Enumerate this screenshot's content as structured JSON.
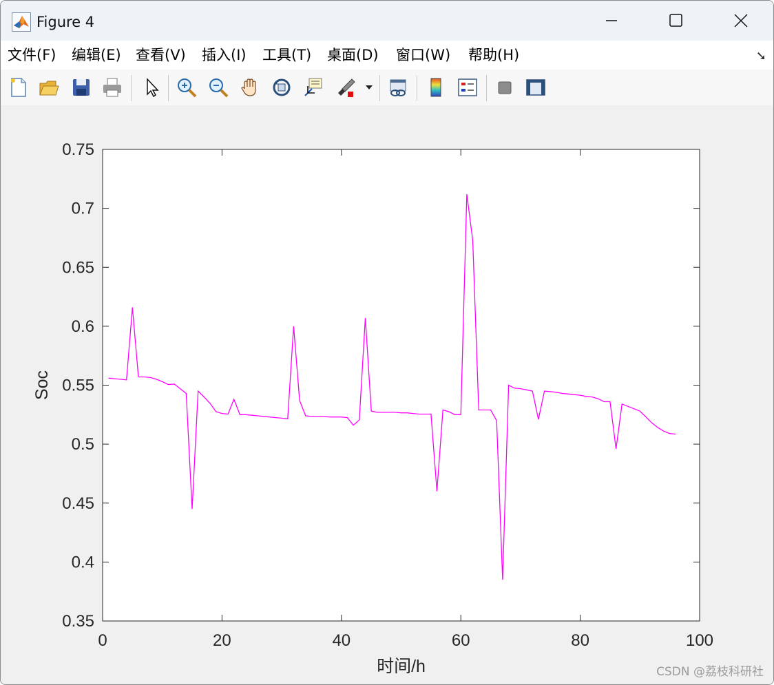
{
  "window": {
    "title": "Figure 4"
  },
  "menu": {
    "items": [
      {
        "label": "文件(F)"
      },
      {
        "label": "编辑(E)"
      },
      {
        "label": "查看(V)"
      },
      {
        "label": "插入(I)"
      },
      {
        "label": "工具(T)"
      },
      {
        "label": "桌面(D)"
      },
      {
        "label": "窗口(W)"
      },
      {
        "label": "帮助(H)"
      }
    ]
  },
  "toolbar": {
    "icons": [
      "new-figure-icon",
      "open-file-icon",
      "save-icon",
      "print-icon",
      "select-arrow-icon",
      "zoom-in-icon",
      "zoom-out-icon",
      "pan-hand-icon",
      "rotate-3d-icon",
      "data-cursor-icon",
      "brush-icon",
      "link-plot-icon",
      "colorbar-icon",
      "legend-icon",
      "hide-plot-tools-icon",
      "show-plot-tools-icon"
    ]
  },
  "colors": {
    "line": "#ff00ff",
    "axes_bg": "#ffffff",
    "figure_bg": "#f0f0f0"
  },
  "watermark": "CSDN @荔枝科研社",
  "chart_data": {
    "type": "line",
    "title": "",
    "xlabel": "时间/h",
    "ylabel": "Soc",
    "xlim": [
      0,
      100
    ],
    "ylim": [
      0.35,
      0.75
    ],
    "xticks": [
      0,
      20,
      40,
      60,
      80,
      100
    ],
    "yticks": [
      0.35,
      0.4,
      0.45,
      0.5,
      0.55,
      0.6,
      0.65,
      0.7,
      0.75
    ],
    "xtick_labels": [
      "0",
      "20",
      "40",
      "60",
      "80",
      "100"
    ],
    "ytick_labels": [
      "0.35",
      "0.4",
      "0.45",
      "0.5",
      "0.55",
      "0.6",
      "0.65",
      "0.7",
      "0.75"
    ],
    "grid": false,
    "series": [
      {
        "color": "#ff00ff",
        "x": [
          1,
          2,
          3,
          4,
          5,
          6,
          7,
          8,
          9,
          10,
          11,
          12,
          13,
          14,
          15,
          16,
          17,
          18,
          19,
          20,
          21,
          22,
          23,
          24,
          25,
          26,
          27,
          28,
          29,
          30,
          31,
          32,
          33,
          34,
          35,
          36,
          37,
          38,
          39,
          40,
          41,
          42,
          43,
          44,
          45,
          46,
          47,
          48,
          49,
          50,
          51,
          52,
          53,
          54,
          55,
          56,
          57,
          58,
          59,
          60,
          61,
          62,
          63,
          64,
          65,
          66,
          67,
          68,
          69,
          70,
          71,
          72,
          73,
          74,
          75,
          76,
          77,
          78,
          79,
          80,
          81,
          82,
          83,
          84,
          85,
          86,
          87,
          88,
          89,
          90,
          91,
          92,
          93,
          94,
          95,
          96
        ],
        "y": [
          0.556,
          0.5555,
          0.555,
          0.5545,
          0.616,
          0.557,
          0.557,
          0.5565,
          0.555,
          0.553,
          0.5505,
          0.551,
          0.547,
          0.543,
          0.445,
          0.545,
          0.54,
          0.5345,
          0.5275,
          0.526,
          0.5255,
          0.538,
          0.525,
          0.525,
          0.5245,
          0.524,
          0.5235,
          0.523,
          0.5225,
          0.522,
          0.5215,
          0.6,
          0.537,
          0.524,
          0.5235,
          0.5235,
          0.5235,
          0.523,
          0.523,
          0.523,
          0.5225,
          0.516,
          0.5205,
          0.607,
          0.528,
          0.527,
          0.527,
          0.527,
          0.527,
          0.5265,
          0.5265,
          0.526,
          0.5255,
          0.5255,
          0.5255,
          0.46,
          0.529,
          0.5275,
          0.525,
          0.525,
          0.712,
          0.673,
          0.529,
          0.529,
          0.529,
          0.52,
          0.385,
          0.55,
          0.5475,
          0.547,
          0.546,
          0.545,
          0.521,
          0.545,
          0.5445,
          0.544,
          0.543,
          0.5425,
          0.542,
          0.5415,
          0.5405,
          0.54,
          0.5385,
          0.536,
          0.536,
          0.496,
          0.534,
          0.532,
          0.53,
          0.528,
          0.523,
          0.518,
          0.514,
          0.511,
          0.509,
          0.5085
        ]
      }
    ]
  }
}
